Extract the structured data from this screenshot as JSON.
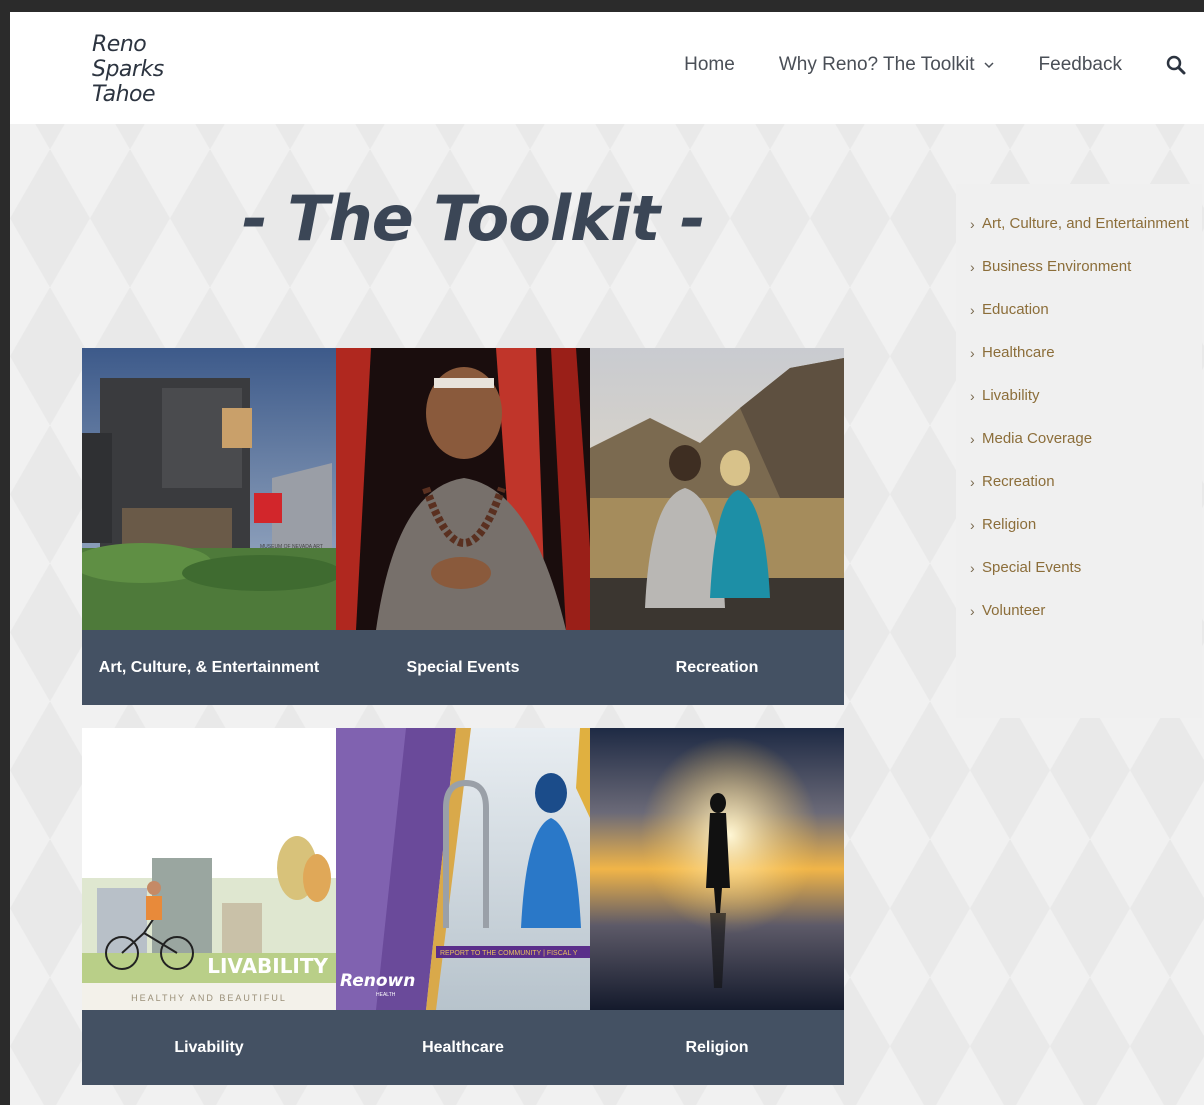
{
  "logo": {
    "line1": "Reno",
    "line2": "Sparks",
    "line3": "Tahoe"
  },
  "nav": {
    "home": "Home",
    "toolkit": "Why Reno? The Toolkit",
    "feedback": "Feedback"
  },
  "page": {
    "title": "- The Toolkit -"
  },
  "tiles": [
    {
      "label": "Art, Culture, & Entertainment"
    },
    {
      "label": "Special Events"
    },
    {
      "label": "Recreation"
    },
    {
      "label": "Livability"
    },
    {
      "label": "Healthcare"
    },
    {
      "label": "Religion"
    }
  ],
  "tile_texts": {
    "museum_sign": "MUSEUM OF NEVADA ART",
    "livability_big": "LIVABILITY",
    "livability_sub": "HEALTHY AND BEAUTIFUL",
    "renown": "Renown",
    "renown_sub": "HEALTH",
    "report": "REPORT TO THE COMMUNITY | FISCAL Y"
  },
  "sidebar": {
    "items": [
      {
        "label": "Art, Culture, and Entertainment"
      },
      {
        "label": "Business Environment"
      },
      {
        "label": "Education"
      },
      {
        "label": "Healthcare"
      },
      {
        "label": "Livability"
      },
      {
        "label": "Media Coverage"
      },
      {
        "label": "Recreation"
      },
      {
        "label": "Religion"
      },
      {
        "label": "Special Events"
      },
      {
        "label": "Volunteer"
      }
    ]
  },
  "colors": {
    "caption_bg": "#445163",
    "sidebar_link": "#8c6e3a",
    "title": "#3b4656"
  }
}
